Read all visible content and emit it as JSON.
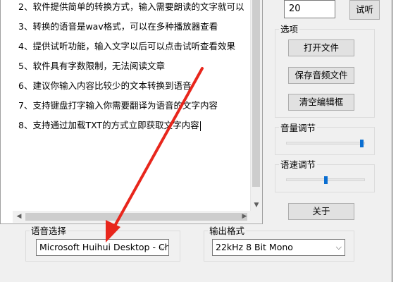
{
  "editor": {
    "lines": [
      "2、软件提供简单的转换方式，输入需要朗读的文字就可以",
      "3、转换的语音是wav格式，可以在多种播放器查看",
      "4、提供试听功能，输入文字以后可以点击试听查看效果",
      "5、软件具有字数限制，无法阅读文章",
      "6、建议你输入内容比较少的文本转换到语音",
      "7、支持键盘打字输入你需要翻译为语音的文字内容",
      "8、支持通过加载TXT的方式立即获取文字内容"
    ]
  },
  "top_controls": {
    "number_value": "20",
    "listen_button": "试听"
  },
  "options": {
    "label": "选项",
    "open_file_button": "打开文件",
    "save_audio_button": "保存音频文件",
    "clear_editor_button": "清空编辑框"
  },
  "volume": {
    "label": "音量调节",
    "level": 0.98
  },
  "speed": {
    "label": "语速调节",
    "level": 0.5
  },
  "about_button": "关于",
  "voice": {
    "label": "语音选择",
    "selected": "Microsoft Huihui Desktop - Chi"
  },
  "output": {
    "label": "输出格式",
    "selected": "22kHz 8 Bit Mono"
  },
  "colors": {
    "annotation_arrow": "#e8261c",
    "trackbar_thumb": "#0a6ed1"
  }
}
